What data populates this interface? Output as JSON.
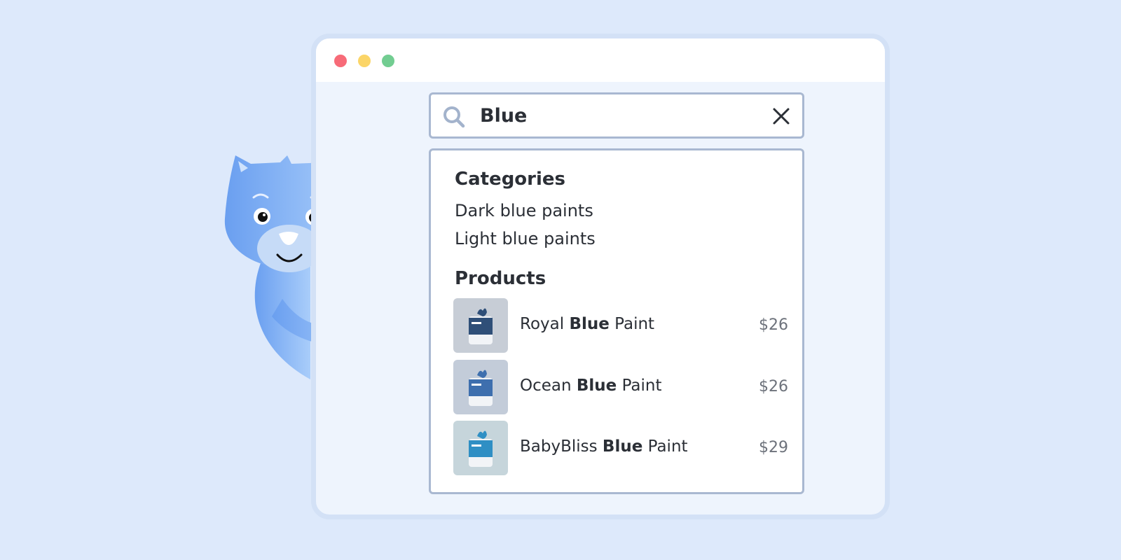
{
  "window": {
    "controls": [
      "close",
      "minimize",
      "maximize"
    ]
  },
  "search": {
    "query": "Blue",
    "icon": "search-icon",
    "clear_icon": "close-icon"
  },
  "results": {
    "categories_heading": "Categories",
    "categories": [
      {
        "label": "Dark blue paints"
      },
      {
        "label": "Light blue paints"
      }
    ],
    "products_heading": "Products",
    "products": [
      {
        "name_before": "Royal ",
        "name_match": "Blue",
        "name_after": " Paint",
        "price": "$26",
        "thumb_bg": "#c7cdd6",
        "paint_color": "#2f4f78"
      },
      {
        "name_before": "Ocean ",
        "name_match": "Blue",
        "name_after": " Paint",
        "price": "$26",
        "thumb_bg": "#c3ccd9",
        "paint_color": "#3e6fae"
      },
      {
        "name_before": "BabyBliss ",
        "name_match": "Blue",
        "name_after": " Paint",
        "price": "$29",
        "thumb_bg": "#c6d5db",
        "paint_color": "#2f8fc4"
      }
    ]
  },
  "colors": {
    "background": "#dde9fb",
    "window_border": "#d3e1f6",
    "input_border": "#a9b8d1",
    "mascot": "#7fb0f5"
  }
}
